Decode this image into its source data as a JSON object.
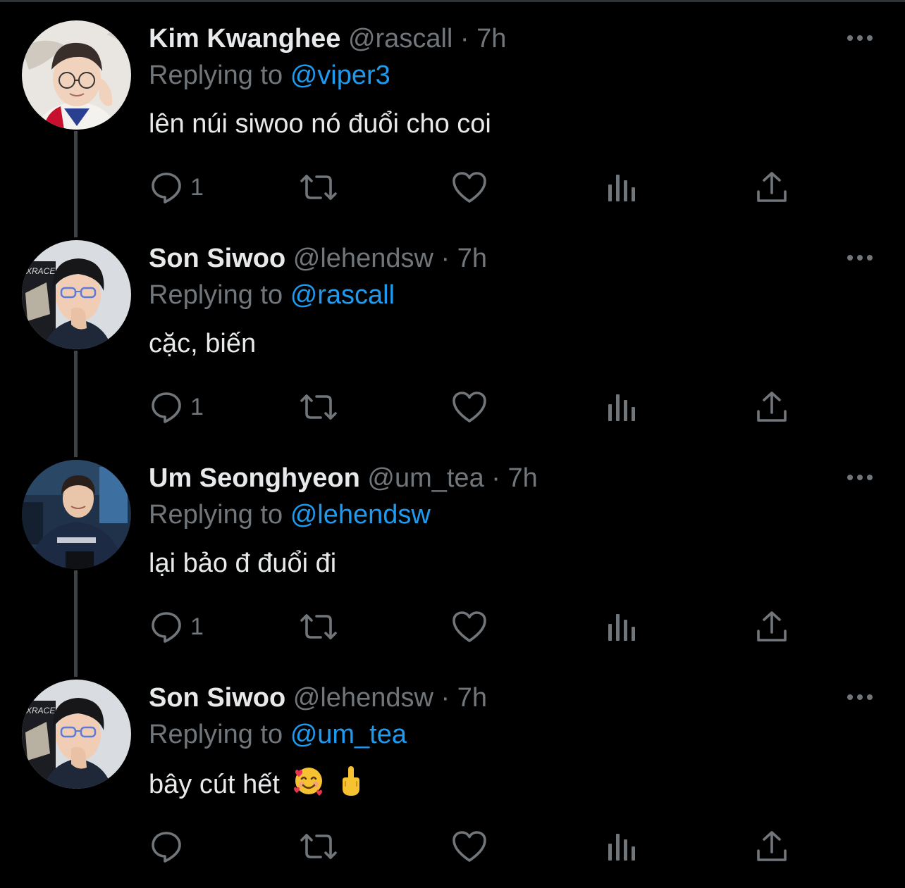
{
  "tweets": [
    {
      "name": "Kim Kwanghee",
      "handle": "@rascall",
      "sep": "·",
      "time": "7h",
      "replying_prefix": "Replying to",
      "replying_to": "@viper3",
      "text": "lên núi siwoo nó đuổi cho coi",
      "reply_count": "1"
    },
    {
      "name": "Son Siwoo",
      "handle": "@lehendsw",
      "sep": "·",
      "time": "7h",
      "replying_prefix": "Replying to",
      "replying_to": "@rascall",
      "text": "cặc, biến",
      "reply_count": "1"
    },
    {
      "name": "Um Seonghyeon",
      "handle": "@um_tea",
      "sep": "·",
      "time": "7h",
      "replying_prefix": "Replying to",
      "replying_to": "@lehendsw",
      "text": "lại bảo đ đuổi đi",
      "reply_count": "1"
    },
    {
      "name": "Son Siwoo",
      "handle": "@lehendsw",
      "sep": "·",
      "time": "7h",
      "replying_prefix": "Replying to",
      "replying_to": "@um_tea",
      "text": "bây cút hết",
      "text_emojis": [
        "smiling-face-with-hearts",
        "middle-finger"
      ],
      "reply_count": ""
    }
  ],
  "icons": {
    "reply": "reply-icon",
    "retweet": "retweet-icon",
    "like": "heart-icon",
    "views": "views-icon",
    "share": "share-icon",
    "more": "more-icon"
  },
  "colors": {
    "background": "#000000",
    "text": "#e7e9ea",
    "muted": "#71767b",
    "link": "#1d9bf0",
    "thread_line": "#3d4247"
  }
}
